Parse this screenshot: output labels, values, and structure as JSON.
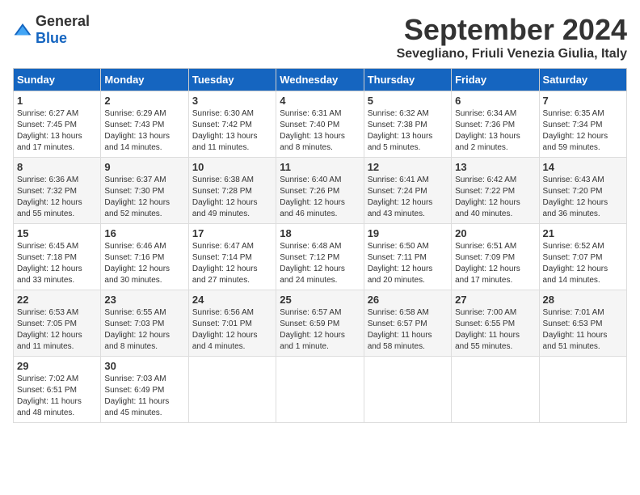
{
  "header": {
    "logo_general": "General",
    "logo_blue": "Blue",
    "month": "September 2024",
    "location": "Sevegliano, Friuli Venezia Giulia, Italy"
  },
  "days_of_week": [
    "Sunday",
    "Monday",
    "Tuesday",
    "Wednesday",
    "Thursday",
    "Friday",
    "Saturday"
  ],
  "weeks": [
    [
      {
        "day": "1",
        "sunrise": "6:27 AM",
        "sunset": "7:45 PM",
        "daylight": "13 hours and 17 minutes."
      },
      {
        "day": "2",
        "sunrise": "6:29 AM",
        "sunset": "7:43 PM",
        "daylight": "13 hours and 14 minutes."
      },
      {
        "day": "3",
        "sunrise": "6:30 AM",
        "sunset": "7:42 PM",
        "daylight": "13 hours and 11 minutes."
      },
      {
        "day": "4",
        "sunrise": "6:31 AM",
        "sunset": "7:40 PM",
        "daylight": "13 hours and 8 minutes."
      },
      {
        "day": "5",
        "sunrise": "6:32 AM",
        "sunset": "7:38 PM",
        "daylight": "13 hours and 5 minutes."
      },
      {
        "day": "6",
        "sunrise": "6:34 AM",
        "sunset": "7:36 PM",
        "daylight": "13 hours and 2 minutes."
      },
      {
        "day": "7",
        "sunrise": "6:35 AM",
        "sunset": "7:34 PM",
        "daylight": "12 hours and 59 minutes."
      }
    ],
    [
      {
        "day": "8",
        "sunrise": "6:36 AM",
        "sunset": "7:32 PM",
        "daylight": "12 hours and 55 minutes."
      },
      {
        "day": "9",
        "sunrise": "6:37 AM",
        "sunset": "7:30 PM",
        "daylight": "12 hours and 52 minutes."
      },
      {
        "day": "10",
        "sunrise": "6:38 AM",
        "sunset": "7:28 PM",
        "daylight": "12 hours and 49 minutes."
      },
      {
        "day": "11",
        "sunrise": "6:40 AM",
        "sunset": "7:26 PM",
        "daylight": "12 hours and 46 minutes."
      },
      {
        "day": "12",
        "sunrise": "6:41 AM",
        "sunset": "7:24 PM",
        "daylight": "12 hours and 43 minutes."
      },
      {
        "day": "13",
        "sunrise": "6:42 AM",
        "sunset": "7:22 PM",
        "daylight": "12 hours and 40 minutes."
      },
      {
        "day": "14",
        "sunrise": "6:43 AM",
        "sunset": "7:20 PM",
        "daylight": "12 hours and 36 minutes."
      }
    ],
    [
      {
        "day": "15",
        "sunrise": "6:45 AM",
        "sunset": "7:18 PM",
        "daylight": "12 hours and 33 minutes."
      },
      {
        "day": "16",
        "sunrise": "6:46 AM",
        "sunset": "7:16 PM",
        "daylight": "12 hours and 30 minutes."
      },
      {
        "day": "17",
        "sunrise": "6:47 AM",
        "sunset": "7:14 PM",
        "daylight": "12 hours and 27 minutes."
      },
      {
        "day": "18",
        "sunrise": "6:48 AM",
        "sunset": "7:12 PM",
        "daylight": "12 hours and 24 minutes."
      },
      {
        "day": "19",
        "sunrise": "6:50 AM",
        "sunset": "7:11 PM",
        "daylight": "12 hours and 20 minutes."
      },
      {
        "day": "20",
        "sunrise": "6:51 AM",
        "sunset": "7:09 PM",
        "daylight": "12 hours and 17 minutes."
      },
      {
        "day": "21",
        "sunrise": "6:52 AM",
        "sunset": "7:07 PM",
        "daylight": "12 hours and 14 minutes."
      }
    ],
    [
      {
        "day": "22",
        "sunrise": "6:53 AM",
        "sunset": "7:05 PM",
        "daylight": "12 hours and 11 minutes."
      },
      {
        "day": "23",
        "sunrise": "6:55 AM",
        "sunset": "7:03 PM",
        "daylight": "12 hours and 8 minutes."
      },
      {
        "day": "24",
        "sunrise": "6:56 AM",
        "sunset": "7:01 PM",
        "daylight": "12 hours and 4 minutes."
      },
      {
        "day": "25",
        "sunrise": "6:57 AM",
        "sunset": "6:59 PM",
        "daylight": "12 hours and 1 minute."
      },
      {
        "day": "26",
        "sunrise": "6:58 AM",
        "sunset": "6:57 PM",
        "daylight": "11 hours and 58 minutes."
      },
      {
        "day": "27",
        "sunrise": "7:00 AM",
        "sunset": "6:55 PM",
        "daylight": "11 hours and 55 minutes."
      },
      {
        "day": "28",
        "sunrise": "7:01 AM",
        "sunset": "6:53 PM",
        "daylight": "11 hours and 51 minutes."
      }
    ],
    [
      {
        "day": "29",
        "sunrise": "7:02 AM",
        "sunset": "6:51 PM",
        "daylight": "11 hours and 48 minutes."
      },
      {
        "day": "30",
        "sunrise": "7:03 AM",
        "sunset": "6:49 PM",
        "daylight": "11 hours and 45 minutes."
      },
      null,
      null,
      null,
      null,
      null
    ]
  ]
}
